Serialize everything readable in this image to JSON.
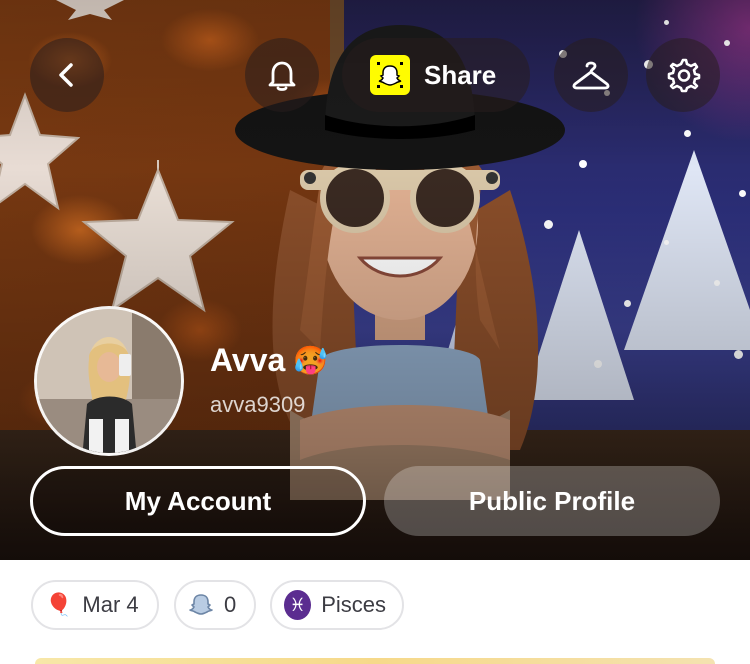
{
  "header": {
    "share_label": "Share",
    "icons": [
      "back-icon",
      "bell-icon",
      "snapcode-icon",
      "hanger-icon",
      "gear-icon"
    ]
  },
  "profile": {
    "display_name": "Avva",
    "name_emoji": "🥵",
    "username": "avva9309"
  },
  "actions": {
    "my_account_label": "My Account",
    "public_profile_label": "Public Profile"
  },
  "chips": {
    "birthday": {
      "icon": "🎈",
      "label": "Mar 4"
    },
    "friends": {
      "icon": "ghost-icon",
      "label": "0"
    },
    "zodiac": {
      "icon": "♓",
      "label": "Pisces"
    }
  },
  "colors": {
    "snap_yellow": "#fffc00",
    "zodiac_purple": "#5b2d90",
    "chip_text": "#3c3c43"
  }
}
